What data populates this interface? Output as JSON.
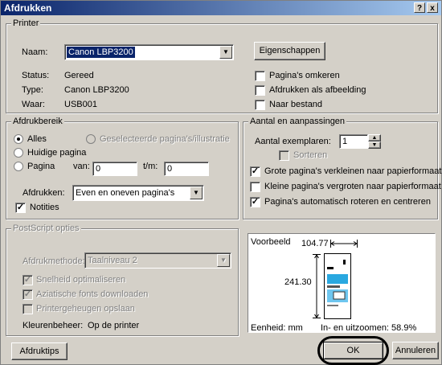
{
  "window": {
    "title": "Afdrukken",
    "help_btn": "?",
    "close_btn": "x"
  },
  "printer": {
    "legend": "Printer",
    "name_label": "Naam:",
    "name_value": "Canon LBP3200",
    "properties_button": "Eigenschappen",
    "status_label": "Status:",
    "status_value": "Gereed",
    "type_label": "Type:",
    "type_value": "Canon LBP3200",
    "where_label": "Waar:",
    "where_value": "USB001",
    "options": [
      {
        "label": "Pagina's omkeren",
        "checked": false
      },
      {
        "label": "Afdrukken als afbeelding",
        "checked": false
      },
      {
        "label": "Naar bestand",
        "checked": false
      }
    ]
  },
  "range": {
    "legend": "Afdrukbereik",
    "all": "Alles",
    "selection": "Geselecteerde pagina's/illustratie",
    "current": "Huidige pagina",
    "pages": "Pagina",
    "from_label": "van:",
    "from_value": "0",
    "to_label": "t/m:",
    "to_value": "0",
    "print_label": "Afdrukken:",
    "print_value": "Even en oneven pagina's",
    "notes": "Notities"
  },
  "copies": {
    "legend": "Aantal en aanpassingen",
    "count_label": "Aantal exemplaren:",
    "count_value": "1",
    "collate": "Sorteren",
    "options": [
      {
        "label": "Grote pagina's verkleinen naar papierformaat",
        "checked": true
      },
      {
        "label": "Kleine pagina's vergroten naar papierformaat",
        "checked": false
      },
      {
        "label": "Pagina's automatisch roteren en centreren",
        "checked": true
      }
    ]
  },
  "postscript": {
    "legend": "PostScript opties",
    "method_label": "Afdrukmethode:",
    "method_value": "Taalniveau 2",
    "fast": "Snelheid optimaliseren",
    "asian": "Aziatische fonts downloaden",
    "save_mem": "Printergeheugen opslaan",
    "color_label": "Kleurenbeheer:",
    "color_value": "Op de printer"
  },
  "preview": {
    "title": "Voorbeeld",
    "width": "104.77",
    "height": "241.30",
    "unit": "Eenheid: mm",
    "zoom": "In- en uitzoomen: 58.9%"
  },
  "buttons": {
    "tips": "Afdruktips",
    "ok": "OK",
    "cancel": "Annuleren"
  }
}
